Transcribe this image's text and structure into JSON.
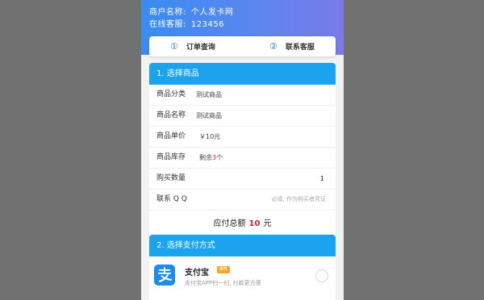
{
  "merchant": {
    "name_label": "商户名称:",
    "name_value": "个人发卡网",
    "service_label": "在线客服:",
    "service_value": "123456"
  },
  "tabs": [
    {
      "num": "①",
      "label": "订单查询"
    },
    {
      "num": "②",
      "label": "联系客服"
    }
  ],
  "section1": {
    "title": "1. 选择商品",
    "rows": {
      "category": {
        "label": "商品分类",
        "value": "测试商品"
      },
      "name": {
        "label": "商品名称",
        "value": "测试商品"
      },
      "price": {
        "label": "商品单价",
        "value": "￥10元"
      },
      "stock": {
        "label": "商品库存",
        "prefix": "剩余",
        "count": "3",
        "suffix": "个"
      },
      "quantity": {
        "label": "购买数量",
        "value": "1"
      },
      "qq": {
        "label": "联系 Q Q",
        "placeholder": "必填, 作为购买者凭证"
      }
    },
    "total": {
      "label": "应付总额",
      "amount": "10",
      "unit": "元"
    }
  },
  "section2": {
    "title": "2. 选择支付方式",
    "methods": [
      {
        "name": "支付宝",
        "badge": "推荐",
        "desc": "支付宝APP扫一扫, 付款更方便",
        "icon": "alipay-icon",
        "selected": false
      }
    ]
  },
  "colors": {
    "header_gradient_start": "#3a8cf0",
    "header_gradient_end": "#7a7ae8",
    "section_header": "#1ba3ee",
    "price": "#e02020",
    "badge": "#f5a623",
    "alipay": "#1a8cf0"
  }
}
